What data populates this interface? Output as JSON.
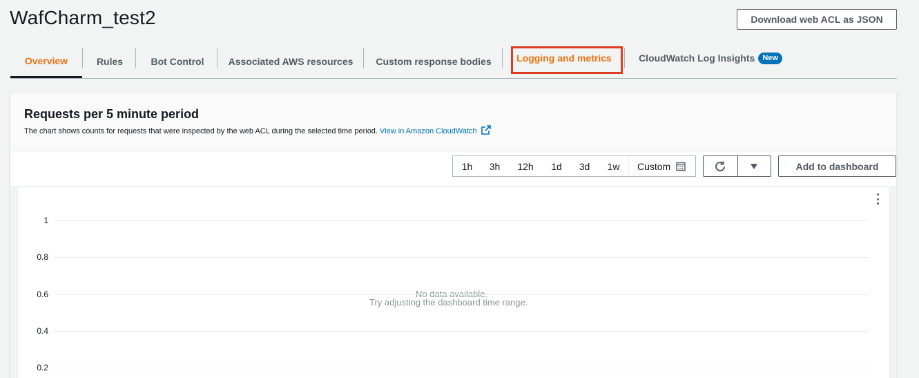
{
  "header": {
    "title": "WafCharm_test2",
    "download_label": "Download web ACL as JSON"
  },
  "tabs": [
    {
      "label": "Overview",
      "active": true
    },
    {
      "label": "Rules"
    },
    {
      "label": "Bot Control"
    },
    {
      "label": "Associated AWS resources"
    },
    {
      "label": "Custom response bodies"
    },
    {
      "label": "Logging and metrics",
      "highlighted": true
    },
    {
      "label": "CloudWatch Log Insights",
      "badge": "New"
    }
  ],
  "panel": {
    "title": "Requests per 5 minute period",
    "description": "The chart shows counts for requests that were inspected by the web ACL during the selected time period.",
    "link_label": "View in Amazon CloudWatch"
  },
  "toolbar": {
    "time_ranges": [
      "1h",
      "3h",
      "12h",
      "1d",
      "3d",
      "1w"
    ],
    "custom_label": "Custom",
    "add_dashboard_label": "Add to dashboard"
  },
  "chart_data": {
    "type": "line",
    "title": "",
    "xlabel": "",
    "ylabel": "",
    "y_ticks": [
      "1",
      "0.8",
      "0.6",
      "0.4",
      "0.2"
    ],
    "ylim": [
      0,
      1
    ],
    "series": [],
    "grid": true,
    "empty_message": "No data available.",
    "empty_hint": "Try adjusting the dashboard time range."
  },
  "colors": {
    "accent_orange": "#ec7211",
    "link_blue": "#0073bb",
    "highlight_box": "#e03c1f"
  }
}
